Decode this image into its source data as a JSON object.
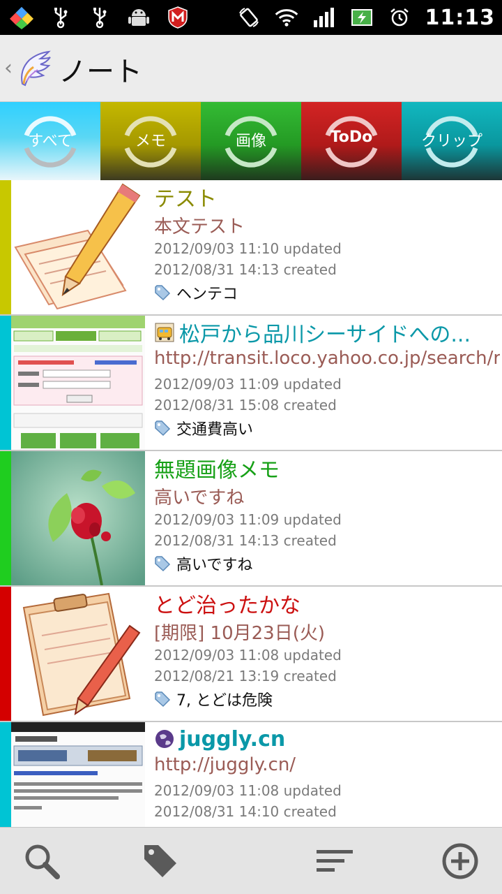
{
  "status_bar": {
    "time": "11:13",
    "icons": [
      "app-diamond-icon",
      "usb-icon",
      "usb-icon",
      "android-debug-icon",
      "mcafee-icon",
      "rotation-icon",
      "wifi-icon",
      "signal-icon",
      "battery-icon",
      "alarm-icon"
    ]
  },
  "action_bar": {
    "title": "ノート",
    "back_glyph": "‹"
  },
  "tabs": [
    {
      "label": "すべて",
      "color": "#2ec6ef"
    },
    {
      "label": "メモ",
      "color": "#b6a800"
    },
    {
      "label": "画像",
      "color": "#27a827"
    },
    {
      "label": "ToDo",
      "color": "#c21d1d"
    },
    {
      "label": "クリップ",
      "color": "#06a9b1"
    }
  ],
  "notes": [
    {
      "stripe_color": "#c8c800",
      "title": "テスト",
      "title_color": "#8a8a00",
      "subtitle": "本文テスト",
      "updated": "2012/09/03 11:10 updated",
      "created": "2012/08/31 14:13 created",
      "tag": "ヘンテコ",
      "thumb": "memo-pencil-icon"
    },
    {
      "stripe_color": "#00c4d4",
      "title": "松戸から品川シーサイドへの...",
      "title_color": "#0a98a8",
      "subtitle": "http://transit.loco.yahoo.co.jp/search/r...",
      "updated": "2012/09/03 11:09 updated",
      "created": "2012/08/31 15:08 created",
      "tag": "交通費高い",
      "thumb": "webpage-screenshot",
      "title_icon": "train-icon"
    },
    {
      "stripe_color": "#1fcd1f",
      "title": "無題画像メモ",
      "title_color": "#16a016",
      "subtitle": "高いですね",
      "updated": "2012/09/03 11:09 updated",
      "created": "2012/08/31 14:13 created",
      "tag": "高いですね",
      "thumb": "flower-photo"
    },
    {
      "stripe_color": "#d40000",
      "title": "とど治ったかな",
      "title_color": "#cc1010",
      "subtitle": "[期限] 10月23日(火)",
      "updated": "2012/09/03 11:08 updated",
      "created": "2012/08/21 13:19 created",
      "tag": "7, とどは危険",
      "thumb": "clipboard-pencil-icon"
    },
    {
      "stripe_color": "#00c4d4",
      "title": "juggly.cn",
      "title_color": "#0a98a8",
      "subtitle": "http://juggly.cn/",
      "updated": "2012/09/03 11:08 updated",
      "created": "2012/08/31 14:10 created",
      "tag": "",
      "thumb": "webpage-screenshot",
      "title_icon": "globe-icon"
    }
  ],
  "bottom_bar": {
    "buttons": [
      "search-icon",
      "tag-icon",
      "sort-icon",
      "add-icon"
    ]
  }
}
